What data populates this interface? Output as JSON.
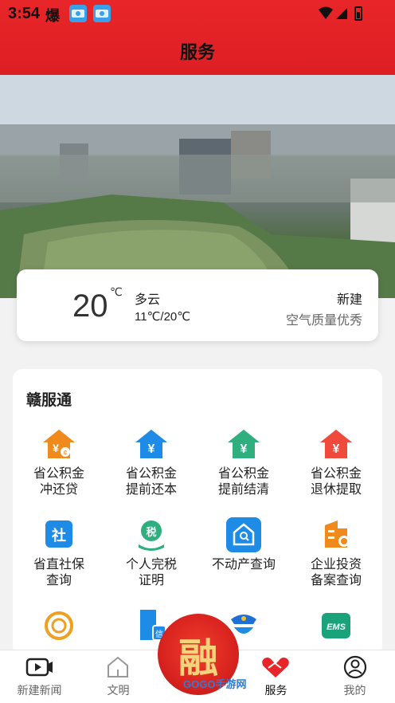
{
  "status_bar": {
    "time": "3:54",
    "app_icon_glyph": "爆",
    "badges": [
      "app-badge-1",
      "app-badge-2"
    ]
  },
  "header": {
    "title": "服务"
  },
  "weather": {
    "temperature": "20",
    "unit": "℃",
    "condition": "多云",
    "range": "11℃/20℃",
    "city": "新建",
    "air_quality": "空气质量优秀"
  },
  "services": {
    "title": "赣服通",
    "items": [
      {
        "label_line1": "省公积金",
        "label_line2": "冲还贷",
        "icon": "house-yen-orange-icon"
      },
      {
        "label_line1": "省公积金",
        "label_line2": "提前还本",
        "icon": "house-yen-blue-icon"
      },
      {
        "label_line1": "省公积金",
        "label_line2": "提前结清",
        "icon": "house-yen-green-icon"
      },
      {
        "label_line1": "省公积金",
        "label_line2": "退休提取",
        "icon": "house-yen-red-icon"
      },
      {
        "label_line1": "省直社保",
        "label_line2": "查询",
        "icon": "social-security-icon"
      },
      {
        "label_line1": "个人完税",
        "label_line2": "证明",
        "icon": "tax-icon"
      },
      {
        "label_line1": "不动产查询",
        "label_line2": "",
        "icon": "property-search-icon"
      },
      {
        "label_line1": "企业投资",
        "label_line2": "备案查询",
        "icon": "enterprise-icon"
      },
      {
        "label_line1": "",
        "label_line2": "",
        "icon": "credit-icon"
      },
      {
        "label_line1": "",
        "label_line2": "",
        "icon": "building-credit-icon"
      },
      {
        "label_line1": "",
        "label_line2": "",
        "icon": "police-icon"
      },
      {
        "label_line1": "",
        "label_line2": "",
        "icon": "ems-icon"
      }
    ]
  },
  "tabbar": {
    "tabs": [
      {
        "label": "新建新闻",
        "icon": "video-icon"
      },
      {
        "label": "文明",
        "icon": "house-icon"
      },
      {
        "label": "服务",
        "icon": "handshake-heart-icon",
        "active": true
      },
      {
        "label": "我的",
        "icon": "profile-icon"
      }
    ],
    "center_glyph": "融",
    "watermark": "GOGO手游网"
  },
  "colors": {
    "brand_red": "#e8262a",
    "orange": "#f08a1c",
    "blue": "#1e8be6",
    "green": "#2fae7e",
    "red": "#ef4a3c"
  }
}
